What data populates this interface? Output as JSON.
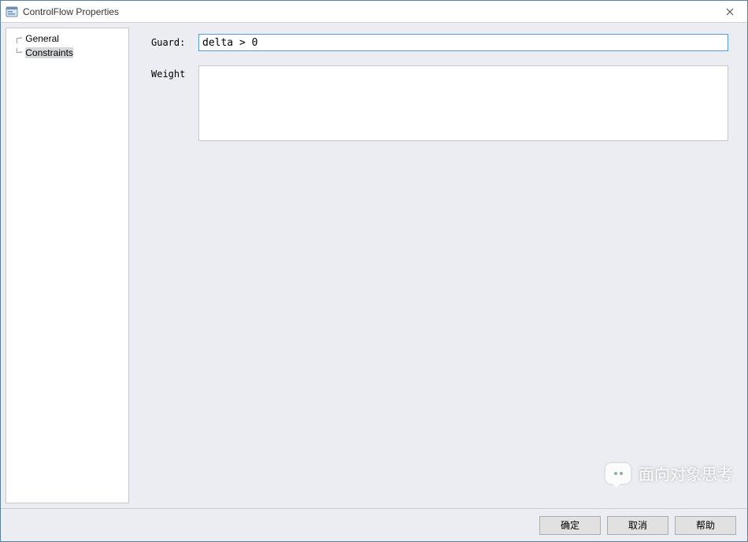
{
  "window": {
    "title": "ControlFlow Properties"
  },
  "sidebar": {
    "items": [
      {
        "label": "General",
        "selected": false
      },
      {
        "label": "Constraints",
        "selected": true
      }
    ]
  },
  "form": {
    "guard": {
      "label": "Guard:",
      "value": "delta > 0"
    },
    "weight": {
      "label": "Weight",
      "value": ""
    }
  },
  "buttons": {
    "ok": "确定",
    "cancel": "取消",
    "help": "帮助"
  },
  "watermark": {
    "text": "面向对象思考"
  }
}
